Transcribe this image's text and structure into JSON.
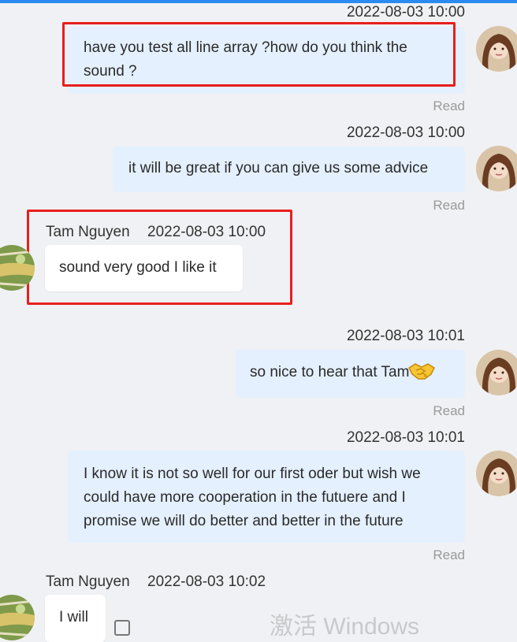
{
  "messages": [
    {
      "time": "2022-08-03 10:00",
      "text": "have you test all line array ?how do you think the sound ?",
      "status": "Read"
    },
    {
      "time": "2022-08-03 10:00",
      "text": "it will be great if you can give us some advice",
      "status": "Read"
    },
    {
      "sender": "Tam Nguyen",
      "time": "2022-08-03 10:00",
      "text": "sound very good I like it"
    },
    {
      "time": "2022-08-03 10:01",
      "text": "so nice to hear that Tam",
      "emoji": "handshake-emoji",
      "status": "Read"
    },
    {
      "time": "2022-08-03 10:01",
      "text": "I know it is not so well for our first oder but wish we could have more cooperation in the futuere and I promise we will do better and better in the future",
      "status": "Read"
    },
    {
      "sender": "Tam Nguyen",
      "time": "2022-08-03 10:02",
      "text": "I will"
    }
  ],
  "watermark": "激活 Windows",
  "colors": {
    "my_bubble": "#e4f0fd",
    "their_bubble": "#ffffff",
    "highlight": "#e81e1e",
    "accent": "#2b8bf0"
  }
}
